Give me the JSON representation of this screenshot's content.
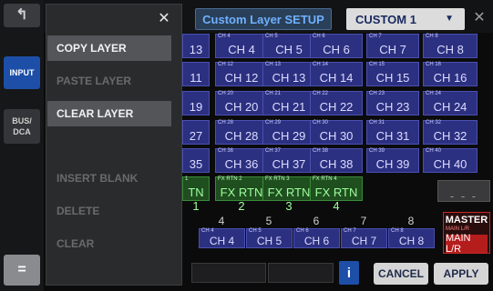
{
  "titlebar": {
    "title": "Custom Layer SETUP",
    "layer_select": "CUSTOM 1",
    "close_glyph": "✕"
  },
  "rail": {
    "back_glyph": "↰",
    "input_label": "INPUT",
    "bus_dca_label": "BUS/\nDCA",
    "menu_glyph": "="
  },
  "menu": {
    "close_glyph": "✕",
    "items": [
      {
        "label": "COPY LAYER",
        "enabled": true
      },
      {
        "label": "PASTE LAYER",
        "enabled": false
      },
      {
        "label": "CLEAR LAYER",
        "enabled": true
      },
      {
        "label": "INSERT BLANK",
        "enabled": false
      },
      {
        "label": "DELETE",
        "enabled": false
      },
      {
        "label": "CLEAR",
        "enabled": false
      }
    ]
  },
  "grid": {
    "rows": [
      [
        {
          "sm": "",
          "lg": "13"
        },
        {
          "sm": "CH 4",
          "lg": "CH 4"
        },
        {
          "sm": "CH 5",
          "lg": "CH 5"
        },
        {
          "sm": "CH 6",
          "lg": "CH 6"
        },
        {
          "sm": "CH 7",
          "lg": "CH 7"
        },
        {
          "sm": "CH 8",
          "lg": "CH 8"
        }
      ],
      [
        {
          "sm": "",
          "lg": "11"
        },
        {
          "sm": "CH 12",
          "lg": "CH 12"
        },
        {
          "sm": "CH 13",
          "lg": "CH 13"
        },
        {
          "sm": "CH 14",
          "lg": "CH 14"
        },
        {
          "sm": "CH 15",
          "lg": "CH 15"
        },
        {
          "sm": "CH 16",
          "lg": "CH 16"
        }
      ],
      [
        {
          "sm": "",
          "lg": "19"
        },
        {
          "sm": "CH 20",
          "lg": "CH 20"
        },
        {
          "sm": "CH 21",
          "lg": "CH 21"
        },
        {
          "sm": "CH 22",
          "lg": "CH 22"
        },
        {
          "sm": "CH 23",
          "lg": "CH 23"
        },
        {
          "sm": "CH 24",
          "lg": "CH 24"
        }
      ],
      [
        {
          "sm": "",
          "lg": "27"
        },
        {
          "sm": "CH 28",
          "lg": "CH 28"
        },
        {
          "sm": "CH 29",
          "lg": "CH 29"
        },
        {
          "sm": "CH 30",
          "lg": "CH 30"
        },
        {
          "sm": "CH 31",
          "lg": "CH 31"
        },
        {
          "sm": "CH 32",
          "lg": "CH 32"
        }
      ],
      [
        {
          "sm": "",
          "lg": "35"
        },
        {
          "sm": "CH 36",
          "lg": "CH 36"
        },
        {
          "sm": "CH 37",
          "lg": "CH 37"
        },
        {
          "sm": "CH 38",
          "lg": "CH 38"
        },
        {
          "sm": "CH 39",
          "lg": "CH 39"
        },
        {
          "sm": "CH 40",
          "lg": "CH 40"
        }
      ],
      [
        {
          "sm": "1",
          "lg": "TN 1",
          "green": true
        },
        {
          "sm": "FX RTN 2",
          "lg": "FX RTN 2",
          "green": true
        },
        {
          "sm": "FX RTN 3",
          "lg": "FX RTN 3",
          "green": true
        },
        {
          "sm": "FX RTN 4",
          "lg": "FX RTN 4",
          "green": true
        },
        {
          "sm": "",
          "lg": "",
          "none": true
        },
        {
          "sm": "",
          "lg": "- - -",
          "empty": true
        }
      ]
    ]
  },
  "bottom": {
    "numbers": [
      "4",
      "5",
      "6",
      "7",
      "8"
    ],
    "cells": [
      {
        "sm": "CH 4",
        "lg": "CH 4"
      },
      {
        "sm": "CH 5",
        "lg": "CH 5"
      },
      {
        "sm": "CH 6",
        "lg": "CH 6"
      },
      {
        "sm": "CH 7",
        "lg": "CH 7"
      },
      {
        "sm": "CH 8",
        "lg": "CH 8"
      }
    ],
    "master": {
      "title": "MASTER",
      "sub": "MAIN L/R",
      "button": "MAIN L/R"
    },
    "info_glyph": "i",
    "cancel": "CANCEL",
    "apply": "APPLY"
  },
  "colors": {
    "accent_blue": "#6fb0ff",
    "channel_blue": "#2c3080",
    "fx_green": "#1f4e1f",
    "master_red": "#b51c1c"
  }
}
